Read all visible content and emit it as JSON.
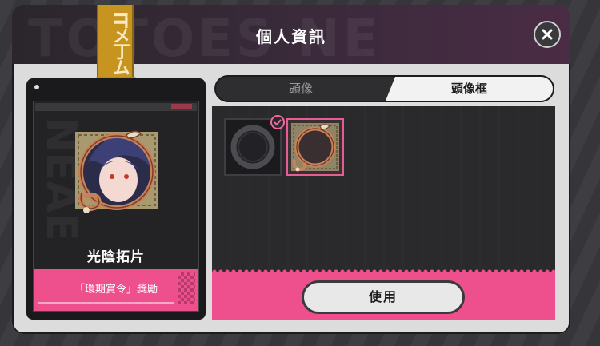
{
  "dialog": {
    "title": "個人資訊",
    "close_icon": "close-icon"
  },
  "lanyard": {
    "text": "ITメ丁ム"
  },
  "badge": {
    "name": "光陰拓片",
    "reward": "「環期賞令」獎勵"
  },
  "tabs": [
    {
      "label": "頭像",
      "active": false
    },
    {
      "label": "頭像框",
      "active": true
    }
  ],
  "frames": [
    {
      "name": "default-frame",
      "selected": true
    },
    {
      "name": "bronze-frame",
      "selected": false,
      "highlighted": true
    }
  ],
  "actions": {
    "use_label": "使用"
  },
  "colors": {
    "accent_pink": "#ee4f8d",
    "header_dark": "#2b262c",
    "lanyard_gold": "#c7941f",
    "panel_dark": "#2a2a2d"
  }
}
